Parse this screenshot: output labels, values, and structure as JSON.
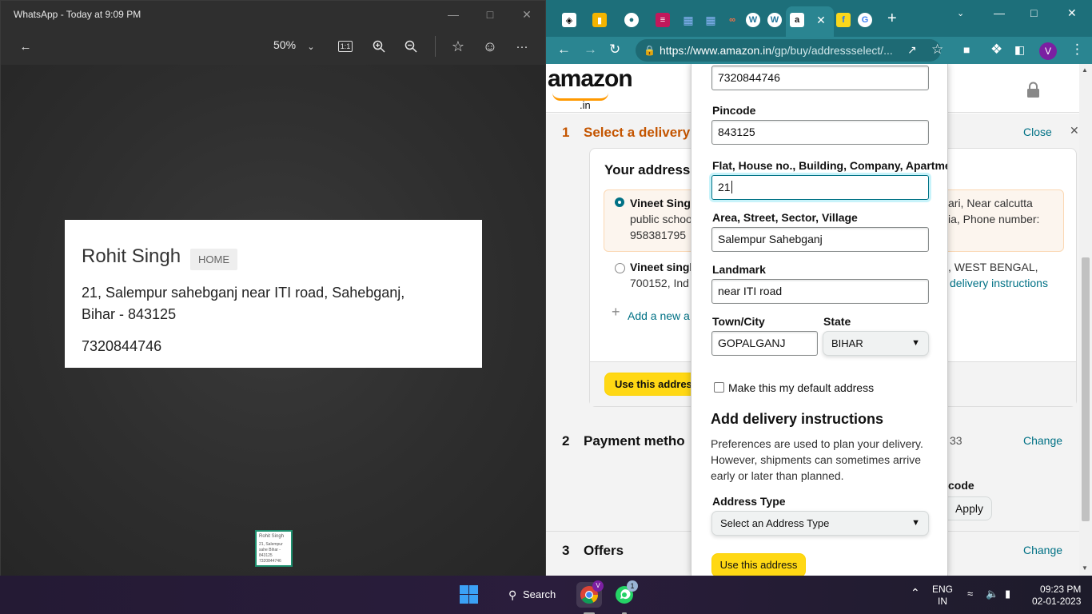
{
  "viewer": {
    "title": "WhatsApp - Today at 9:09 PM",
    "zoom": "50%",
    "toolbar_actual_size": "1:1",
    "card": {
      "name": "Rohit Singh",
      "tag": "HOME",
      "address_line1": "21, Salempur sahebganj near ITI road, Sahebganj,",
      "address_line2": "Bihar - 843125",
      "phone": "7320844746"
    },
    "thumb": {
      "name": "Rohit Singh",
      "address": "21, Salempur sahe Bihar - 843125",
      "phone": "7320844746"
    }
  },
  "browser": {
    "url_host": "https://www.amazon.in",
    "url_path": "/gp/buy/addressselect/...",
    "avatar_letter": "V",
    "tab_favicons": [
      "codepen-icon",
      "app-icon",
      "globe-icon",
      "app-icon",
      "grid-icon",
      "grid-icon",
      "link-icon",
      "wordpress-icon",
      "wordpress-icon",
      "amazon-icon",
      "close-icon",
      "flipkart-icon",
      "google-icon"
    ]
  },
  "amazon": {
    "logo": "amazon",
    "logo_in": ".in",
    "step1_num": "1",
    "step1_title": "Select a delivery",
    "close": "Close",
    "your_addresses": "Your address",
    "addr1_name": "Vineet Sing",
    "addr1_line_a": "public schoo",
    "addr1_line_b": "958381795",
    "addr1_right_a": "ari, Near calcutta",
    "addr1_right_b": "ia, Phone number:",
    "addr2_name": "Vineet singl",
    "addr2_line_a": "700152, Ind",
    "addr2_right_a": ", WEST BENGAL,",
    "addr2_right_b": "delivery instructions",
    "add_new": "Add a new a",
    "use_address_bg": "Use this address",
    "step2_num": "2",
    "step2_title": "Payment metho",
    "step2_val": "33",
    "change": "Change",
    "code_label": "code",
    "apply": "Apply",
    "step3_num": "3",
    "step3_title": "Offers"
  },
  "modal": {
    "phone_value": "7320844746",
    "pincode_label": "Pincode",
    "pincode_value": "843125",
    "flat_label": "Flat, House no., Building, Company, Apartme",
    "flat_value": "21",
    "area_label": "Area, Street, Sector, Village",
    "area_value": "Salempur Sahebganj",
    "landmark_label": "Landmark",
    "landmark_value": "near ITI road",
    "town_label": "Town/City",
    "town_value": "GOPALGANJ",
    "state_label": "State",
    "state_value": "BIHAR",
    "default_label": "Make this my default address",
    "instructions_heading": "Add delivery instructions",
    "instructions_text": "Preferences are used to plan your delivery. However, shipments can sometimes arrive early or later than planned.",
    "address_type_label": "Address Type",
    "address_type_value": "Select an Address Type",
    "use_address": "Use this address"
  },
  "taskbar": {
    "search": "Search",
    "whatsapp_badge": "1",
    "chrome_badge": "V",
    "lang_top": "ENG",
    "lang_bottom": "IN",
    "time": "09:23 PM",
    "date": "02-01-2023"
  }
}
